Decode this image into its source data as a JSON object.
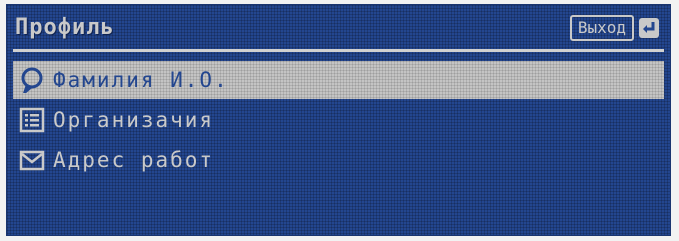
{
  "header": {
    "title": "Профиль",
    "exit_label": "Выход",
    "exit_icon": "return-arrow-icon"
  },
  "menu": {
    "items": [
      {
        "label": "Фамилия И.О.",
        "icon": "person-icon",
        "selected": true
      },
      {
        "label": "Организачия",
        "icon": "list-icon",
        "selected": false
      },
      {
        "label": "Адрес работ",
        "icon": "envelope-icon",
        "selected": false
      }
    ]
  },
  "colors": {
    "screen_background": "#23468f",
    "text": "#c9c9c9",
    "selection_background": "#c4c4c4"
  }
}
